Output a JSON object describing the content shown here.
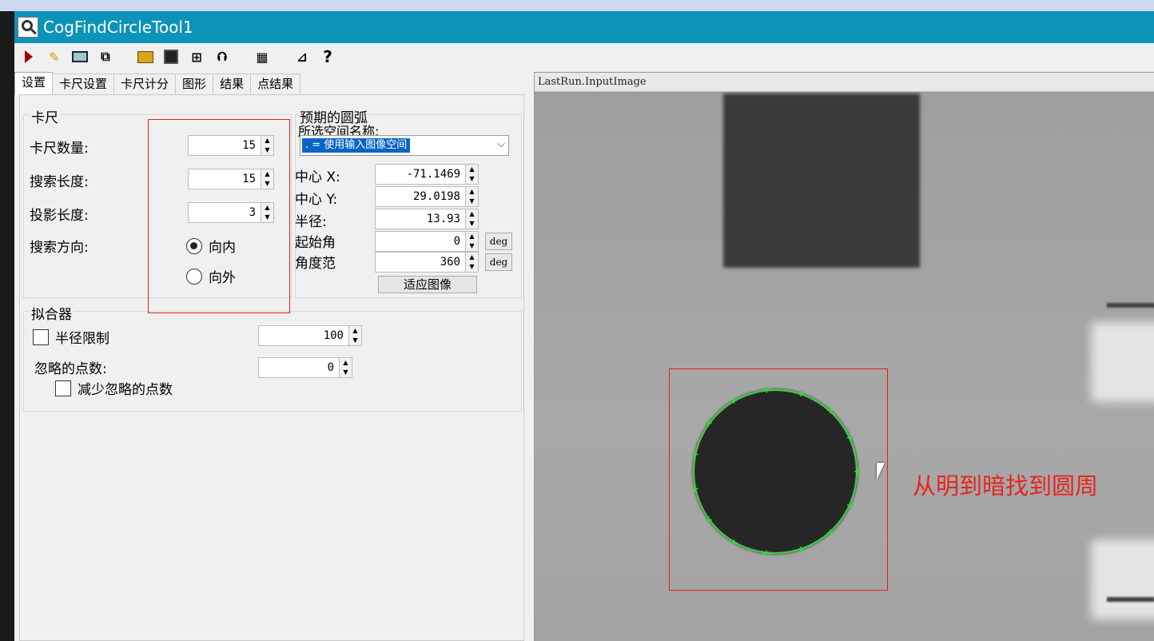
{
  "window": {
    "title": "CogFindCircleTool1"
  },
  "toolbar": {
    "buttons": [
      "run-icon",
      "edit-icon",
      "display-icon",
      "copy-icon",
      "open-icon",
      "save-icon",
      "link-icon",
      "import-icon",
      "calculator-icon",
      "measure-icon",
      "help-icon"
    ]
  },
  "tabs": [
    "设置",
    "卡尺设置",
    "卡尺计分",
    "图形",
    "结果",
    "点结果"
  ],
  "caliper": {
    "group_title": "卡尺",
    "count_label": "卡尺数量:",
    "count_value": "15",
    "search_length_label": "搜索长度:",
    "search_length_value": "15",
    "projection_length_label": "投影长度:",
    "projection_length_value": "3",
    "search_direction_label": "搜索方向:",
    "direction_inward": "向内",
    "direction_outward": "向外",
    "direction_selected": "向内"
  },
  "arc": {
    "group_title": "预期的圆弧",
    "space_label": "所选空间名称:",
    "space_value": ". = 使用输入图像空间",
    "center_x_label": "中心 X:",
    "center_x_value": "-71.1469",
    "center_y_label": "中心 Y:",
    "center_y_value": "29.0198",
    "radius_label": "半径:",
    "radius_value": "13.93",
    "start_angle_label": "起始角",
    "start_angle_value": "0",
    "start_angle_unit": "deg",
    "angle_span_label": "角度范",
    "angle_span_value": "360",
    "angle_span_unit": "deg",
    "fit_image_button": "适应图像"
  },
  "fitter": {
    "group_title": "拟合器",
    "radius_limit_label": "半径限制",
    "radius_limit_checked": false,
    "radius_limit_value": "100",
    "ignore_points_label": "忽略的点数:",
    "ignore_points_value": "0",
    "reduce_ignore_label": "减少忽略的点数",
    "reduce_ignore_checked": false
  },
  "image": {
    "header": "LastRun.InputImage"
  },
  "annotation": {
    "text": "从明到暗找到圆周",
    "color": "#e8231f"
  },
  "colors": {
    "titlebar": "#0b93b8",
    "fit_circle": "#3dd43d",
    "highlight_box": "#e02020"
  }
}
